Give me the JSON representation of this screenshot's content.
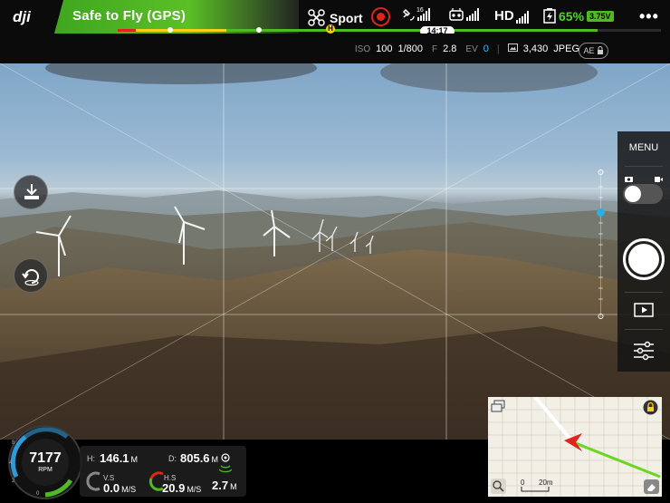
{
  "top_bar": {
    "brand": "dji",
    "flight_status": "Safe to Fly (GPS)",
    "flight_mode": "Sport",
    "satellite_count": "16",
    "video_link": "HD",
    "battery_percent": "65%",
    "battery_voltage": "3.75V",
    "remaining_flight_time": "14:17",
    "home_marker": "H",
    "more_label": "•••"
  },
  "camera_bar": {
    "iso_label": "ISO",
    "iso": "100",
    "shutter": "1/800",
    "aperture_label": "F",
    "aperture": "2.8",
    "ev_label": "EV",
    "ev": "0",
    "photos_remaining": "3,430",
    "format": "JPEG",
    "ae_label": "AE"
  },
  "right_panel": {
    "menu_label": "MENU"
  },
  "telemetry": {
    "rpm": "7177",
    "rpm_label": "RPM",
    "height_label": "H:",
    "height": "146.1",
    "height_unit": "M",
    "distance_label": "D:",
    "distance": "805.6",
    "distance_unit": "M",
    "vs_label": "V.S",
    "vs": "0.0",
    "vs_unit": "M/S",
    "hs_label": "H.S",
    "hs": "20.9",
    "hs_unit": "M/S",
    "obstacle_distance": "2.7",
    "obstacle_unit": "M"
  },
  "minimap": {
    "scale_start": "0",
    "scale_end": "20m"
  },
  "colors": {
    "status_green": "#4fbb20",
    "battery_green": "#4fd61e",
    "ev_blue": "#3ab8ff",
    "warning_red": "#e0231b",
    "home_yellow": "#f7d117"
  }
}
